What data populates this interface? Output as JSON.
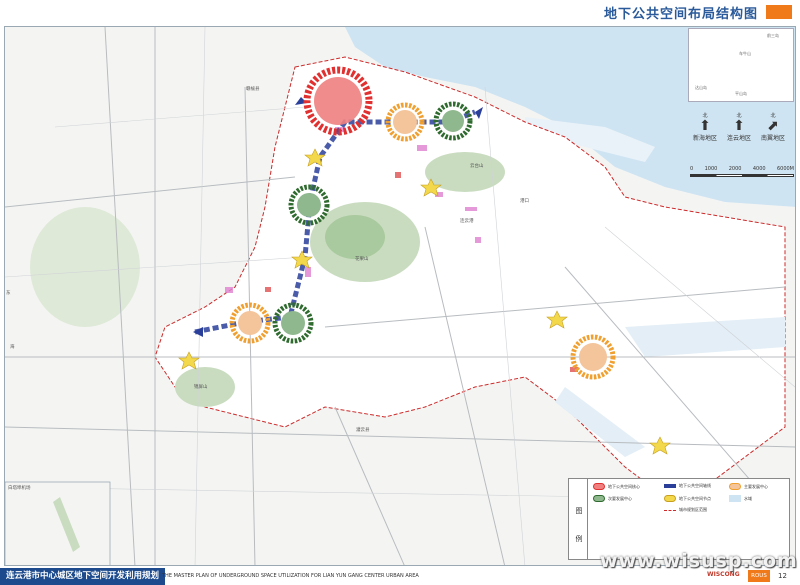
{
  "header": {
    "title": "地下公共空间布局结构图",
    "accent_color": "#f07a1a"
  },
  "map": {
    "place_labels": [
      {
        "id": "ganyu",
        "text": "赣榆县"
      },
      {
        "id": "donghai",
        "text": "东"
      },
      {
        "id": "haizhou",
        "text": "海"
      },
      {
        "id": "guanyun",
        "text": "灌云县"
      },
      {
        "id": "yuntai",
        "text": "云台山"
      },
      {
        "id": "huaguo",
        "text": "花果山"
      },
      {
        "id": "jinping",
        "text": "锦屏山"
      },
      {
        "id": "east",
        "text": "港口"
      },
      {
        "id": "lianyun",
        "text": "连云港"
      },
      {
        "id": "baita",
        "text": "白塔埠机场"
      }
    ]
  },
  "inset": {
    "labels": [
      {
        "id": "island1",
        "text": "前三岛"
      },
      {
        "id": "island2",
        "text": "车牛山"
      },
      {
        "id": "island3",
        "text": "达山岛"
      },
      {
        "id": "island4",
        "text": "平山岛"
      }
    ]
  },
  "compass": [
    {
      "north": "北",
      "label": "新海地区"
    },
    {
      "north": "北",
      "label": "连云地区"
    },
    {
      "north": "北",
      "label": "南翼地区"
    }
  ],
  "scale": {
    "ticks": [
      "0",
      "1000",
      "2000",
      "4000",
      "6000M"
    ]
  },
  "legend": {
    "title": "图例",
    "items": [
      {
        "id": "core",
        "label": "地下公共空间核心",
        "color": "#e03030"
      },
      {
        "id": "axis",
        "label": "地下公共空间轴线",
        "color": "#2a3f9a"
      },
      {
        "id": "main",
        "label": "主要发展中心",
        "color": "#f0a030"
      },
      {
        "id": "sub",
        "label": "次要发展中心",
        "color": "#3a8a3a"
      },
      {
        "id": "node",
        "label": "地下公共空间节点",
        "color": "#f2d84a"
      },
      {
        "id": "water",
        "label": "水域",
        "color": "#cfe4f2"
      },
      {
        "id": "boundary",
        "label": "城市规划区范围",
        "color": "#cc2a2a"
      }
    ]
  },
  "footer": {
    "title_cn": "连云港市中心城区地下空间开发利用规划",
    "title_en": "THE MASTER PLAN OF UNDERGROUND SPACE UTILIZATION FOR LIAN YUN GANG CENTER URBAN AREA",
    "logo": "WISCONG",
    "badge": "ROUS",
    "page": "12",
    "watermark": "www.wisusp.com"
  }
}
